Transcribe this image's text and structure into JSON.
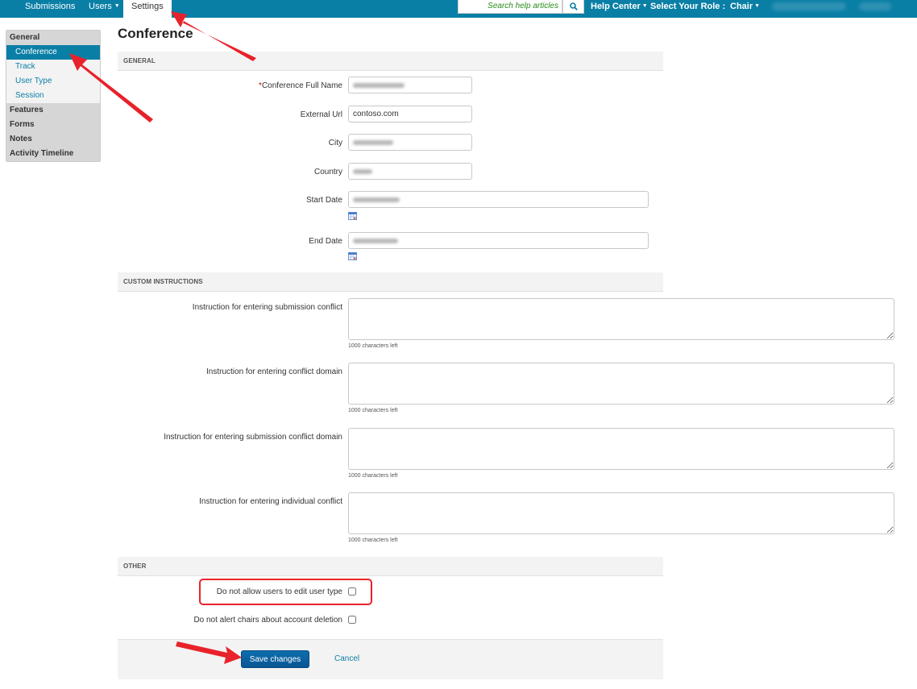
{
  "topnav": {
    "tabs": [
      {
        "label": "Submissions",
        "has_caret": false,
        "active": false
      },
      {
        "label": "Users",
        "has_caret": true,
        "active": false
      },
      {
        "label": "Settings",
        "has_caret": false,
        "active": true
      }
    ],
    "search_placeholder": "Search help articles",
    "search_icon": "search-icon",
    "help_center_label": "Help Center",
    "role_label": "Select Your Role :",
    "role_value": "Chair"
  },
  "sidebar": {
    "groups": [
      {
        "label": "General",
        "items": [
          {
            "label": "Conference",
            "active": true
          },
          {
            "label": "Track",
            "active": false
          },
          {
            "label": "User Type",
            "active": false
          },
          {
            "label": "Session",
            "active": false
          }
        ]
      },
      {
        "label": "Features",
        "items": []
      },
      {
        "label": "Forms",
        "items": []
      },
      {
        "label": "Notes",
        "items": []
      },
      {
        "label": "Activity Timeline",
        "items": []
      }
    ]
  },
  "main": {
    "title": "Conference",
    "sections": {
      "general": "GENERAL",
      "custom_instructions": "CUSTOM INSTRUCTIONS",
      "other": "OTHER"
    },
    "fields": {
      "full_name": {
        "required_mark": "*",
        "label": "Conference Full Name",
        "value": ""
      },
      "external_url": {
        "label": "External Url",
        "value": "contoso.com"
      },
      "city": {
        "label": "City",
        "value": ""
      },
      "country": {
        "label": "Country",
        "value": ""
      },
      "start_date": {
        "label": "Start Date",
        "value": ""
      },
      "end_date": {
        "label": "End Date",
        "value": ""
      }
    },
    "instructions": [
      {
        "label": "Instruction for entering submission conflict",
        "chars_left": "1000 characters left"
      },
      {
        "label": "Instruction for entering conflict domain",
        "chars_left": "1000 characters left"
      },
      {
        "label": "Instruction for entering submission conflict domain",
        "chars_left": "1000 characters left"
      },
      {
        "label": "Instruction for entering individual conflict",
        "chars_left": "1000 characters left"
      }
    ],
    "other": [
      {
        "label": "Do not allow users to edit user type",
        "checked": false
      },
      {
        "label": "Do not alert chairs about account deletion",
        "checked": false
      }
    ],
    "save_label": "Save changes",
    "cancel_label": "Cancel"
  },
  "colors": {
    "brand": "#0a7fa6",
    "save_button": "#0a5f9e",
    "annotation_red": "#e8222a"
  }
}
